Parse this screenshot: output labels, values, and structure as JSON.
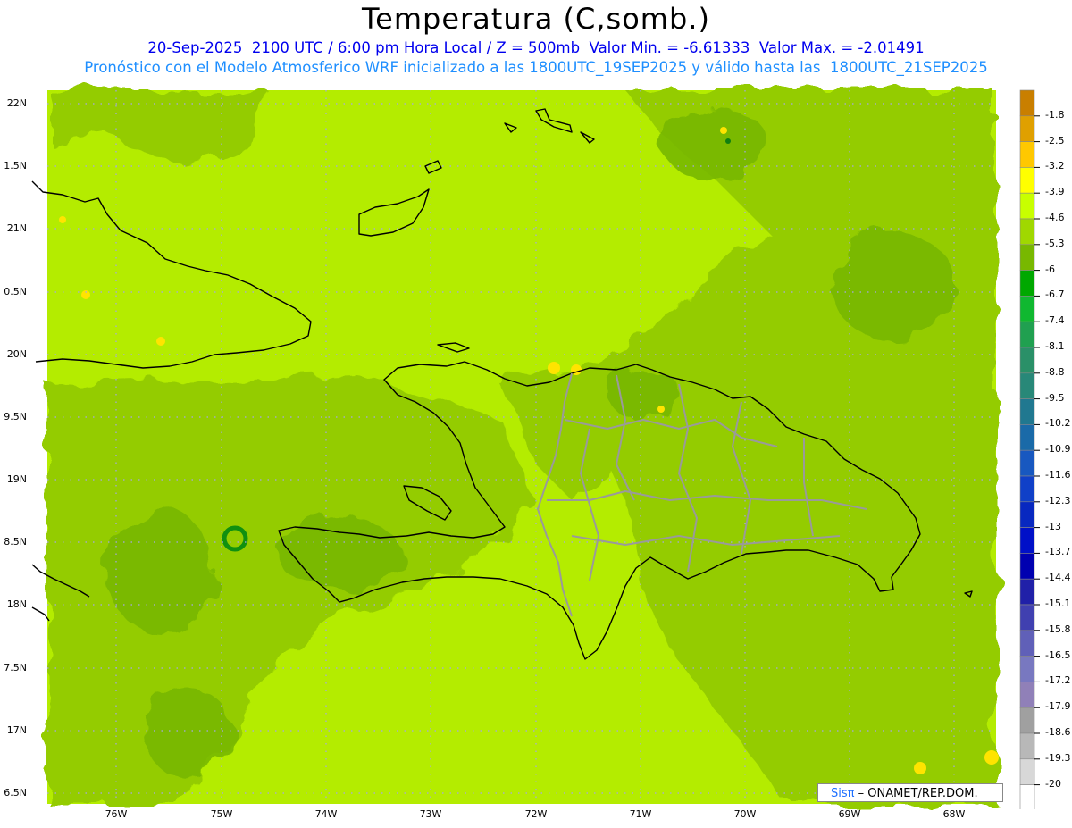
{
  "header": {
    "title": "Temperatura (C,somb.)",
    "line1": "20-Sep-2025  2100 UTC / 6:00 pm Hora Local / Z = 500mb  Valor Min. = -6.61333  Valor Max. = -2.01491",
    "line2": "Pronóstico con el Modelo Atmosferico WRF inicializado a las 1800UTC_19SEP2025 y válido hasta las  1800UTC_21SEP2025"
  },
  "axes": {
    "lat_labels": [
      "22N",
      "1.5N",
      "21N",
      "0.5N",
      "20N",
      "9.5N",
      "19N",
      "8.5N",
      "18N",
      "7.5N",
      "17N",
      "6.5N"
    ],
    "lon_labels": [
      "76W",
      "75W",
      "74W",
      "73W",
      "72W",
      "71W",
      "70W",
      "69W",
      "68W"
    ]
  },
  "colorbar": {
    "labels": [
      "-1.8",
      "-2.5",
      "-3.2",
      "-3.9",
      "-4.6",
      "-5.3",
      "-6",
      "-6.7",
      "-7.4",
      "-8.1",
      "-8.8",
      "-9.5",
      "-10.2",
      "-10.9",
      "-11.6",
      "-12.3",
      "-13",
      "-13.7",
      "-14.4",
      "-15.1",
      "-15.8",
      "-16.5",
      "-17.2",
      "-17.9",
      "-18.6",
      "-19.3",
      "-20"
    ],
    "colors": [
      "#c97f00",
      "#e0a000",
      "#ffc800",
      "#ffff00",
      "#c8ff00",
      "#a0d800",
      "#78b800",
      "#00a800",
      "#10b830",
      "#20a050",
      "#2a9068",
      "#288878",
      "#207890",
      "#1a6aa8",
      "#1858c0",
      "#1040c8",
      "#0828c0",
      "#0010c8",
      "#0000b0",
      "#2020a8",
      "#4040b0",
      "#6060b8",
      "#7878c0",
      "#9080b8",
      "#a0a0a0",
      "#b8b8b8",
      "#d8d8d8",
      "#ffffff"
    ]
  },
  "credit": {
    "logo": "Sisπ",
    "text": "– ONAMET/REP.DOM."
  }
}
